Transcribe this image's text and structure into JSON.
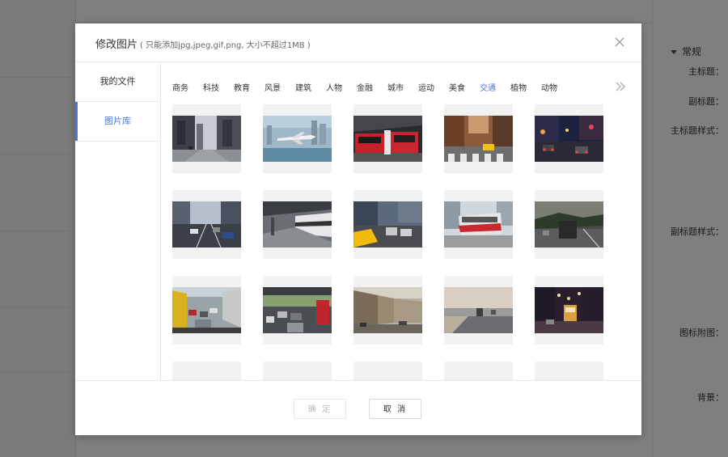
{
  "background": {
    "section_title": "常规",
    "properties": [
      "主标题：",
      "副标题：",
      "主标题样式：",
      "副标题样式：",
      "图标附图：",
      "背景："
    ]
  },
  "modal": {
    "title": "修改图片",
    "hint": "( 只能添加jpg,jpeg,gif,png, 大小不超过1MB )",
    "close_icon": "close-icon"
  },
  "sidebar": {
    "items": [
      {
        "label": "我的文件",
        "active": false
      },
      {
        "label": "图片库",
        "active": true
      }
    ]
  },
  "categories": {
    "items": [
      "商务",
      "科技",
      "教育",
      "风景",
      "建筑",
      "人物",
      "金融",
      "城市",
      "运动",
      "美食",
      "交通",
      "植物",
      "动物"
    ],
    "active": "交通",
    "more_icon": "double-chevron-right-icon"
  },
  "images": [
    {
      "subject": "city-street"
    },
    {
      "subject": "airplane-over-city"
    },
    {
      "subject": "red-train-station"
    },
    {
      "subject": "crosswalk-taxi"
    },
    {
      "subject": "night-traffic"
    },
    {
      "subject": "highway-cars"
    },
    {
      "subject": "train-platform"
    },
    {
      "subject": "yellow-taxi"
    },
    {
      "subject": "red-tram"
    },
    {
      "subject": "truck-road"
    },
    {
      "subject": "traffic-jam"
    },
    {
      "subject": "traffic-jam-red-truck"
    },
    {
      "subject": "old-street-buildings"
    },
    {
      "subject": "road-by-water"
    },
    {
      "subject": "tram-at-night"
    },
    {
      "subject": "partial"
    },
    {
      "subject": "partial"
    },
    {
      "subject": "partial"
    },
    {
      "subject": "partial"
    },
    {
      "subject": "partial"
    }
  ],
  "footer": {
    "confirm_label": "确 定",
    "cancel_label": "取 消"
  },
  "colors": {
    "accent": "#4a7ad6",
    "overlay": "rgba(0,0,0,0.5)"
  }
}
